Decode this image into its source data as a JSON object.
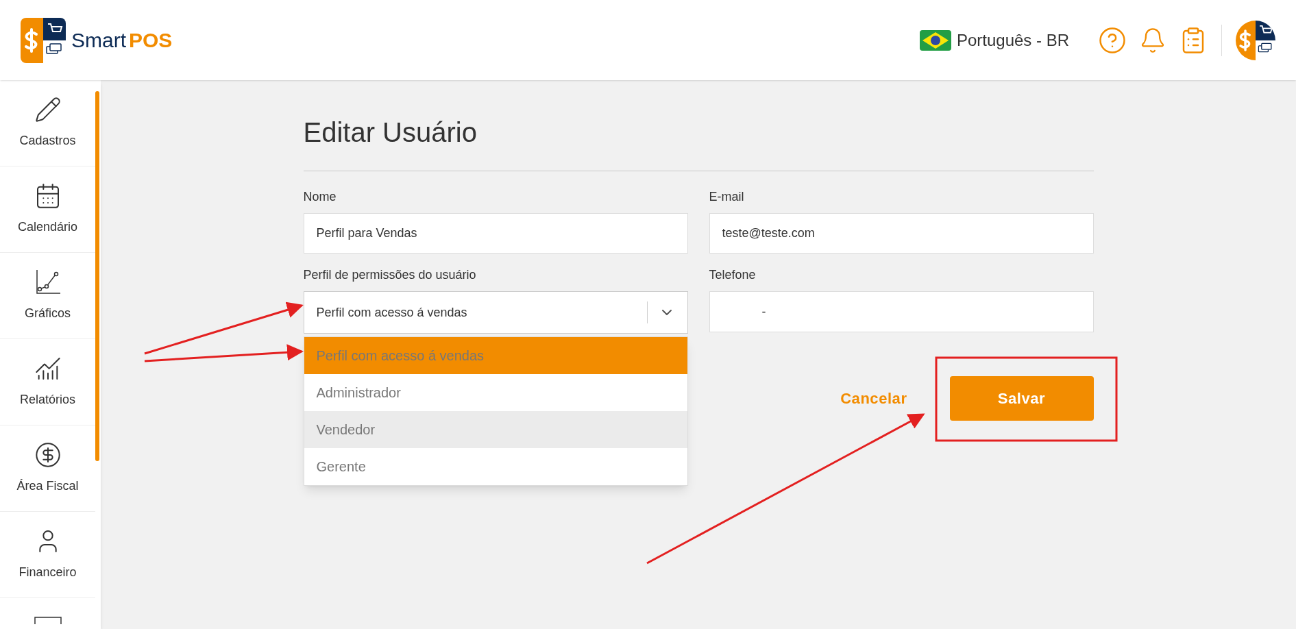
{
  "header": {
    "logo": {
      "word_1": "Smart",
      "word_2": "POS"
    },
    "language": "Português - BR"
  },
  "sidebar": {
    "items": [
      {
        "label": "Cadastros"
      },
      {
        "label": "Calendário"
      },
      {
        "label": "Gráficos"
      },
      {
        "label": "Relatórios"
      },
      {
        "label": "Área Fiscal"
      },
      {
        "label": "Financeiro"
      }
    ]
  },
  "form": {
    "title": "Editar Usuário",
    "name": {
      "label": "Nome",
      "value": "Perfil para Vendas"
    },
    "email": {
      "label": "E-mail",
      "value": "teste@teste.com"
    },
    "profile": {
      "label": "Perfil de permissões do usuário",
      "value": "Perfil com acesso á vendas",
      "expanded": true,
      "options": [
        {
          "label": "Perfil com acesso á vendas",
          "selected": true,
          "hovered": false
        },
        {
          "label": "Administrador",
          "selected": false,
          "hovered": false
        },
        {
          "label": "Vendedor",
          "selected": false,
          "hovered": true
        },
        {
          "label": "Gerente",
          "selected": false,
          "hovered": false
        }
      ]
    },
    "phone": {
      "label": "Telefone",
      "value": "-"
    },
    "cancel": "Cancelar",
    "save": "Salvar"
  }
}
